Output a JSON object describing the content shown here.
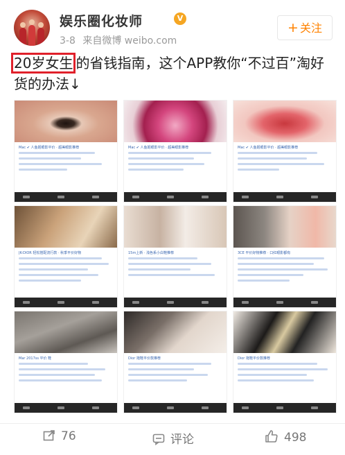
{
  "post": {
    "author": "娱乐圈化妆师",
    "verified_badge": "V",
    "date": "3-8",
    "source": "来自微博 weibo.com",
    "follow_label": "关注",
    "follow_plus": "+",
    "text_highlight": "20岁女生",
    "text_rest": "的省钱指南，这个APP教你“不过百”淘好货的办法↓"
  },
  "cards": [
    {
      "title": "Mac ✔ 人鱼姬眼影平价 · 超美眼影推荐"
    },
    {
      "title": "Mac ✔ 人鱼姬眼影平价 · 超美眼影推荐"
    },
    {
      "title": "Mac ✔ 人鱼姬眼影平价 · 超美眼影推荐"
    },
    {
      "title": "JK-DIOR 轻松搭配流行款 · 秋季平价好物"
    },
    {
      "title": "15m上新 · 浅色系小白鞋推荐"
    },
    {
      "title": "3CE 平价好物推荐 · 口红眼影都有"
    },
    {
      "title": "Mar 2017ss 平价 鞋"
    },
    {
      "title": "Dior 拖鞋平价款推荐"
    },
    {
      "title": "Dior 拖鞋平价款推荐"
    }
  ],
  "actions": {
    "repost_count": "76",
    "comment_label": "评论",
    "like_count": "498"
  },
  "colors": {
    "accent": "#ff8200",
    "highlight_box": "#e0202a",
    "link": "#3a67b0"
  }
}
